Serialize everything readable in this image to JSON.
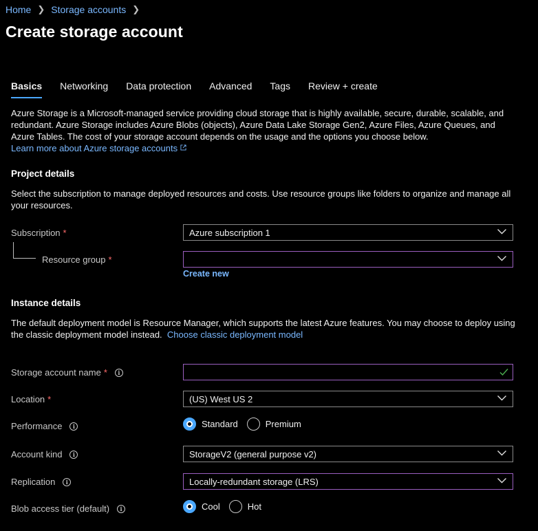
{
  "breadcrumb": [
    {
      "label": "Home"
    },
    {
      "label": "Storage accounts"
    }
  ],
  "page_title": "Create storage account",
  "tabs": [
    {
      "label": "Basics",
      "active": true
    },
    {
      "label": "Networking",
      "active": false
    },
    {
      "label": "Data protection",
      "active": false
    },
    {
      "label": "Advanced",
      "active": false
    },
    {
      "label": "Tags",
      "active": false
    },
    {
      "label": "Review + create",
      "active": false
    }
  ],
  "intro": {
    "text": "Azure Storage is a Microsoft-managed service providing cloud storage that is highly available, secure, durable, scalable, and redundant. Azure Storage includes Azure Blobs (objects), Azure Data Lake Storage Gen2, Azure Files, Azure Queues, and Azure Tables. The cost of your storage account depends on the usage and the options you choose below.",
    "link": "Learn more about Azure storage accounts"
  },
  "project": {
    "title": "Project details",
    "description": "Select the subscription to manage deployed resources and costs. Use resource groups like folders to organize and manage all your resources.",
    "subscription_label": "Subscription",
    "subscription_value": "Azure subscription 1",
    "resource_group_label": "Resource group",
    "create_new": "Create new"
  },
  "instance": {
    "title": "Instance details",
    "description": "The default deployment model is Resource Manager, which supports the latest Azure features. You may choose to deploy using the classic deployment model instead.",
    "classic_link": "Choose classic deployment model",
    "name_label": "Storage account name",
    "location_label": "Location",
    "location_value": "(US) West US 2",
    "performance_label": "Performance",
    "performance_options": [
      "Standard",
      "Premium"
    ],
    "performance_selected": "Standard",
    "kind_label": "Account kind",
    "kind_value": "StorageV2 (general purpose v2)",
    "replication_label": "Replication",
    "replication_value": "Locally-redundant storage (LRS)",
    "tier_label": "Blob access tier (default)",
    "tier_options": [
      "Cool",
      "Hot"
    ],
    "tier_selected": "Cool"
  },
  "required_marker": "*",
  "colors": {
    "accent": "#4aa8ff",
    "link": "#7ab8ff",
    "required": "#ff6b6b",
    "valid": "#4caf50",
    "focus_border": "#9b5fc0"
  }
}
